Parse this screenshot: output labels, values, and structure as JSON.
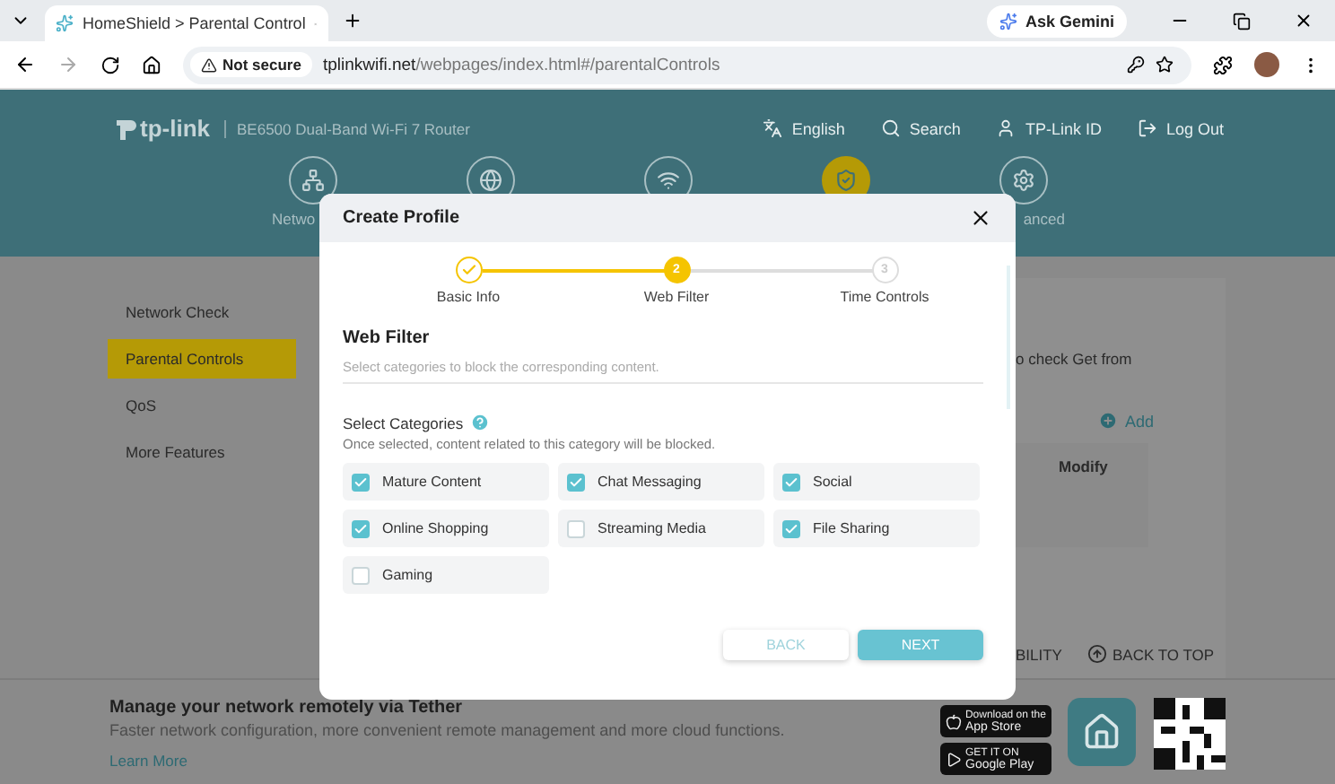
{
  "browser": {
    "tab_title": "HomeShield > Parental Control",
    "assistant": "Ask Gemini",
    "security": "Not secure",
    "url_host": "tplinkwifi.net",
    "url_path": "/webpages/index.html#/parentalControls"
  },
  "header": {
    "logo": "tp-link",
    "model": "BE6500 Dual-Band Wi-Fi 7 Router",
    "menu": [
      {
        "kind": "language",
        "label": "English"
      },
      {
        "kind": "search",
        "label": "Search"
      },
      {
        "kind": "account",
        "label": "TP-Link ID"
      },
      {
        "kind": "logout",
        "label": "Log Out"
      }
    ],
    "nav": [
      {
        "kind": "network",
        "label": "Netwo",
        "selected": false
      },
      {
        "kind": "internet",
        "selected": false
      },
      {
        "kind": "wireless",
        "selected": false
      },
      {
        "kind": "homeshield",
        "selected": true
      },
      {
        "kind": "advanced",
        "label": "anced",
        "selected": false
      }
    ]
  },
  "sidebar": {
    "items": [
      {
        "label": "Network Check",
        "selected": false
      },
      {
        "label": "Parental Controls",
        "selected": true
      },
      {
        "label": "QoS",
        "selected": false
      },
      {
        "label": "More Features",
        "selected": false
      }
    ]
  },
  "content": {
    "note": "o check Get from",
    "add": "Add",
    "column": "Modify",
    "visibility": "BILITY",
    "back_to_top": "BACK TO TOP"
  },
  "modal": {
    "title": "Create Profile",
    "steps": [
      {
        "label": "Basic Info",
        "completed": true,
        "selected": false
      },
      {
        "label": "Web Filter",
        "number": "2",
        "completed": false,
        "selected": true
      },
      {
        "label": "Time Controls",
        "number": "3",
        "completed": false,
        "selected": false
      }
    ],
    "heading": "Web Filter",
    "subtitle": "Select categories to block the corresponding content.",
    "categories_label": "Select Categories",
    "hint": "Once selected, content related to this category will be blocked.",
    "categories": [
      {
        "label": "Mature Content",
        "checked": true
      },
      {
        "label": "Chat Messaging",
        "checked": true
      },
      {
        "label": "Social",
        "checked": true
      },
      {
        "label": "Online Shopping",
        "checked": true
      },
      {
        "label": "Streaming Media",
        "checked": false
      },
      {
        "label": "File Sharing",
        "checked": true
      },
      {
        "label": "Gaming",
        "checked": false
      }
    ],
    "back": "BACK",
    "next": "NEXT"
  },
  "footer": {
    "title": "Manage your network remotely via Tether",
    "text": "Faster network configuration, more convenient remote management and more cloud functions.",
    "link": "Learn More",
    "badges": [
      {
        "kind": "apple",
        "caption": "Download on the",
        "label": "App Store"
      },
      {
        "kind": "google",
        "caption": "GET IT ON",
        "label": "Google Play"
      }
    ]
  }
}
